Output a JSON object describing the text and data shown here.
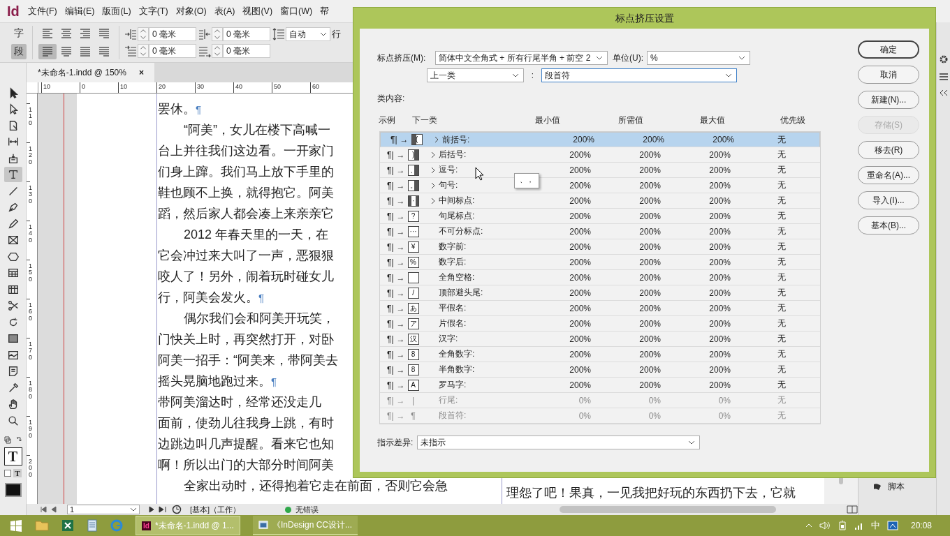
{
  "app": {
    "logo": "Id"
  },
  "menu": [
    "文件(F)",
    "编辑(E)",
    "版面(L)",
    "文字(T)",
    "对象(O)",
    "表(A)",
    "视图(V)",
    "窗口(W)",
    "帮"
  ],
  "control_bar": {
    "mode_buttons": [
      {
        "label": "字",
        "selected": false
      },
      {
        "label": "段",
        "selected": true
      }
    ],
    "align_buttons": [
      {
        "kind": "left",
        "selected": false
      },
      {
        "kind": "center",
        "selected": false
      },
      {
        "kind": "right",
        "selected": false
      },
      {
        "kind": "spine",
        "selected": false
      },
      {
        "kind": "justify-left",
        "selected": true
      },
      {
        "kind": "justify-center",
        "selected": false
      },
      {
        "kind": "justify-all",
        "selected": false
      },
      {
        "kind": "justify-right",
        "selected": false
      }
    ],
    "fields": [
      {
        "kind": "left-indent",
        "value": "0 毫米"
      },
      {
        "kind": "right-indent",
        "value": "0 毫米"
      },
      {
        "kind": "first-indent",
        "value": "0 毫米"
      },
      {
        "kind": "last-indent",
        "value": "0 毫米"
      }
    ],
    "leading": {
      "value": "自动"
    },
    "cut_label": "行"
  },
  "toolbox": [
    {
      "kind": "selection",
      "selected": false
    },
    {
      "kind": "direct",
      "selected": false
    },
    {
      "kind": "page",
      "selected": false
    },
    {
      "kind": "gap",
      "selected": false
    },
    {
      "kind": "collector",
      "selected": false
    },
    {
      "kind": "type",
      "selected": true
    },
    {
      "kind": "line",
      "selected": false
    },
    {
      "kind": "pen",
      "selected": false
    },
    {
      "kind": "pencil",
      "selected": false
    },
    {
      "kind": "frame",
      "selected": false
    },
    {
      "kind": "polygon",
      "selected": false
    },
    {
      "kind": "grid",
      "selected": false
    },
    {
      "kind": "table",
      "selected": false
    },
    {
      "kind": "scissors",
      "selected": false
    },
    {
      "kind": "rotate",
      "selected": false
    },
    {
      "kind": "gradient",
      "selected": false
    },
    {
      "kind": "feather",
      "selected": false
    },
    {
      "kind": "note",
      "selected": false
    },
    {
      "kind": "eyedropper",
      "selected": false
    },
    {
      "kind": "hand",
      "selected": false
    },
    {
      "kind": "zoom",
      "selected": false
    }
  ],
  "toolbox_bottom": {
    "fill_letter": "T",
    "format_letter": "T"
  },
  "document": {
    "tab": {
      "title": "*未命名-1.indd @ 150%",
      "close": "×"
    },
    "ruler_h": [
      "10",
      "0",
      "10",
      "20",
      "30",
      "40",
      "50",
      "60"
    ],
    "ruler_v": [
      "110",
      "120",
      "130",
      "140",
      "150",
      "160",
      "170",
      "180",
      "190",
      "200"
    ],
    "lines": [
      {
        "text": "罢休。",
        "indent": false,
        "mark": "¶"
      },
      {
        "text": "“阿美”，女儿在楼下高喊一",
        "indent": true
      },
      {
        "text": "台上并往我们这边看。一开家门",
        "indent": false
      },
      {
        "text": "们身上蹿。我们马上放下手里的",
        "indent": false
      },
      {
        "text": "鞋也顾不上换，就得抱它。阿美",
        "indent": false
      },
      {
        "text": "蹈，然后家人都会凑上来亲亲它",
        "indent": false
      },
      {
        "text": "2012 年春天里的一天，在",
        "indent": true
      },
      {
        "text": "它会冲过来大叫了一声，恶狠狠",
        "indent": false
      },
      {
        "text": "咬人了！另外，闹着玩时碰女儿",
        "indent": false
      },
      {
        "text": "行，阿美会发火。",
        "indent": false,
        "mark": "¶"
      },
      {
        "text": "偶尔我们会和阿美开玩笑，",
        "indent": true
      },
      {
        "text": "门快关上时，再突然打开，对卧",
        "indent": false
      },
      {
        "text": "阿美一招手：“阿美来，带阿美去",
        "indent": false
      },
      {
        "text": "摇头晃脑地跑过来。",
        "indent": false,
        "mark": "¶"
      },
      {
        "text": "带阿美溜达时，经常还没走几",
        "indent": false
      },
      {
        "text": "面前，使劲儿往我身上跳，有时",
        "indent": false
      },
      {
        "text": "边跳边叫几声提醒。看来它也知",
        "indent": false
      },
      {
        "text": "啊！所以出门的大部分时间阿美",
        "indent": false
      },
      {
        "text": "全家出动时，还得抱着它走在前面，否则它会急",
        "indent": true
      }
    ],
    "facing_lines": [
      {
        "text": "理怨了吧！果真，一见我把好玩的东西扔下去，它就"
      }
    ]
  },
  "status_bar": {
    "page": "1",
    "master": "[基本]（工作）",
    "preflight": "无错误"
  },
  "panel": {
    "items": [
      {
        "label": "脚本"
      }
    ]
  },
  "dialog": {
    "title": "标点挤压设置",
    "set_label": "标点挤压(M):",
    "set_value": "简体中文全角式 + 所有行尾半角 + 前空 2",
    "unit_label": "单位(U):",
    "unit_value": "%",
    "class_value": "上一类",
    "colon": ":",
    "target_value": "段首符",
    "content_label": "类内容:",
    "columns": [
      "示例",
      "下一类",
      "最小值",
      "所需值",
      "最大值",
      "优先级"
    ],
    "rows": [
      {
        "from": "¶|",
        "arrow": "→",
        "kind": "left",
        "glyph": "(",
        "expandable": true,
        "name": "前括号:",
        "min": "200%",
        "desired": "200%",
        "max": "200%",
        "priority": "无",
        "selected": true,
        "disabled": false
      },
      {
        "from": "¶|",
        "arrow": "→",
        "kind": "right",
        "glyph": ")",
        "expandable": true,
        "name": "后括号:",
        "min": "200%",
        "desired": "200%",
        "max": "200%",
        "priority": "无",
        "selected": false,
        "disabled": false
      },
      {
        "from": "¶|",
        "arrow": "→",
        "kind": "right",
        "glyph": "、",
        "expandable": true,
        "name": "逗号:",
        "min": "200%",
        "desired": "200%",
        "max": "200%",
        "priority": "无",
        "selected": false,
        "disabled": false
      },
      {
        "from": "¶|",
        "arrow": "→",
        "kind": "right",
        "glyph": "。",
        "expandable": true,
        "name": "句号:",
        "min": "200%",
        "desired": "200%",
        "max": "200%",
        "priority": "无",
        "selected": false,
        "disabled": false
      },
      {
        "from": "¶|",
        "arrow": "→",
        "kind": "both",
        "glyph": "·",
        "expandable": true,
        "name": "中间标点:",
        "min": "200%",
        "desired": "200%",
        "max": "200%",
        "priority": "无",
        "selected": false,
        "disabled": false
      },
      {
        "from": "¶|",
        "arrow": "→",
        "kind": "plain",
        "glyph": "?",
        "expandable": false,
        "name": "句尾标点:",
        "min": "200%",
        "desired": "200%",
        "max": "200%",
        "priority": "无",
        "selected": false,
        "disabled": false
      },
      {
        "from": "¶|",
        "arrow": "→",
        "kind": "plain",
        "glyph": "···",
        "expandable": false,
        "name": "不可分标点:",
        "min": "200%",
        "desired": "200%",
        "max": "200%",
        "priority": "无",
        "selected": false,
        "disabled": false
      },
      {
        "from": "¶|",
        "arrow": "→",
        "kind": "plain",
        "glyph": "¥",
        "expandable": false,
        "name": "数字前:",
        "min": "200%",
        "desired": "200%",
        "max": "200%",
        "priority": "无",
        "selected": false,
        "disabled": false
      },
      {
        "from": "¶|",
        "arrow": "→",
        "kind": "plain",
        "glyph": "%",
        "expandable": false,
        "name": "数字后:",
        "min": "200%",
        "desired": "200%",
        "max": "200%",
        "priority": "无",
        "selected": false,
        "disabled": false
      },
      {
        "from": "¶|",
        "arrow": "→",
        "kind": "plain",
        "expandable": false,
        "name": "全角空格:",
        "min": "200%",
        "desired": "200%",
        "max": "200%",
        "priority": "无",
        "selected": false,
        "disabled": false
      },
      {
        "from": "¶|",
        "arrow": "→",
        "kind": "plain",
        "glyph": "/",
        "expandable": false,
        "name": "顶部避头尾:",
        "min": "200%",
        "desired": "200%",
        "max": "200%",
        "priority": "无",
        "selected": false,
        "disabled": false
      },
      {
        "from": "¶|",
        "arrow": "→",
        "kind": "plain",
        "glyph": "あ",
        "expandable": false,
        "name": "平假名:",
        "min": "200%",
        "desired": "200%",
        "max": "200%",
        "priority": "无",
        "selected": false,
        "disabled": false
      },
      {
        "from": "¶|",
        "arrow": "→",
        "kind": "plain",
        "glyph": "ア",
        "expandable": false,
        "name": "片假名:",
        "min": "200%",
        "desired": "200%",
        "max": "200%",
        "priority": "无",
        "selected": false,
        "disabled": false
      },
      {
        "from": "¶|",
        "arrow": "→",
        "kind": "plain",
        "glyph": "汉",
        "expandable": false,
        "name": "汉字:",
        "min": "200%",
        "desired": "200%",
        "max": "200%",
        "priority": "无",
        "selected": false,
        "disabled": false
      },
      {
        "from": "¶|",
        "arrow": "→",
        "kind": "plain",
        "glyph": "8",
        "expandable": false,
        "name": "全角数字:",
        "min": "200%",
        "desired": "200%",
        "max": "200%",
        "priority": "无",
        "selected": false,
        "disabled": false
      },
      {
        "from": "¶|",
        "arrow": "→",
        "kind": "plain",
        "glyph": "8",
        "expandable": false,
        "name": "半角数字:",
        "min": "200%",
        "desired": "200%",
        "max": "200%",
        "priority": "无",
        "selected": false,
        "disabled": false
      },
      {
        "from": "¶|",
        "arrow": "→",
        "kind": "plain",
        "glyph": "A",
        "expandable": false,
        "name": "罗马字:",
        "min": "200%",
        "desired": "200%",
        "max": "200%",
        "priority": "无",
        "selected": false,
        "disabled": false
      },
      {
        "from": "¶|",
        "arrow": "→",
        "kind": "bare",
        "glyph": "|",
        "expandable": false,
        "name": "行尾:",
        "min": "0%",
        "desired": "0%",
        "max": "0%",
        "priority": "无",
        "selected": false,
        "disabled": true
      },
      {
        "from": "¶|",
        "arrow": "→",
        "kind": "bare",
        "glyph": "¶",
        "expandable": false,
        "name": "段首符:",
        "min": "0%",
        "desired": "0%",
        "max": "0%",
        "priority": "无",
        "selected": false,
        "disabled": true
      }
    ],
    "tooltip": "、，",
    "diff_label": "指示差异:",
    "diff_value": "未指示",
    "buttons": [
      {
        "label": "确定",
        "default": true,
        "disabled": false
      },
      {
        "label": "取消",
        "default": false,
        "disabled": false
      },
      {
        "label": "新建(N)...",
        "default": false,
        "disabled": false
      },
      {
        "label": "存储(S)",
        "default": false,
        "disabled": true
      },
      {
        "label": "移去(R)",
        "default": false,
        "disabled": false
      },
      {
        "label": "重命名(A)...",
        "default": false,
        "disabled": false
      },
      {
        "label": "导入(I)...",
        "default": false,
        "disabled": false
      },
      {
        "label": "基本(B)...",
        "default": false,
        "disabled": false
      }
    ]
  },
  "taskbar": {
    "apps": [
      {
        "kind": "folder"
      },
      {
        "kind": "excel"
      },
      {
        "kind": "notepad"
      },
      {
        "kind": "browser"
      }
    ],
    "tasks": [
      {
        "kind": "indesign",
        "badge": "Id",
        "title": "*未命名-1.indd @ 1...",
        "selected": true
      },
      {
        "kind": "document",
        "title": "《InDesign CC设计...",
        "selected": false
      }
    ],
    "ime": "中",
    "time": "20:08"
  }
}
